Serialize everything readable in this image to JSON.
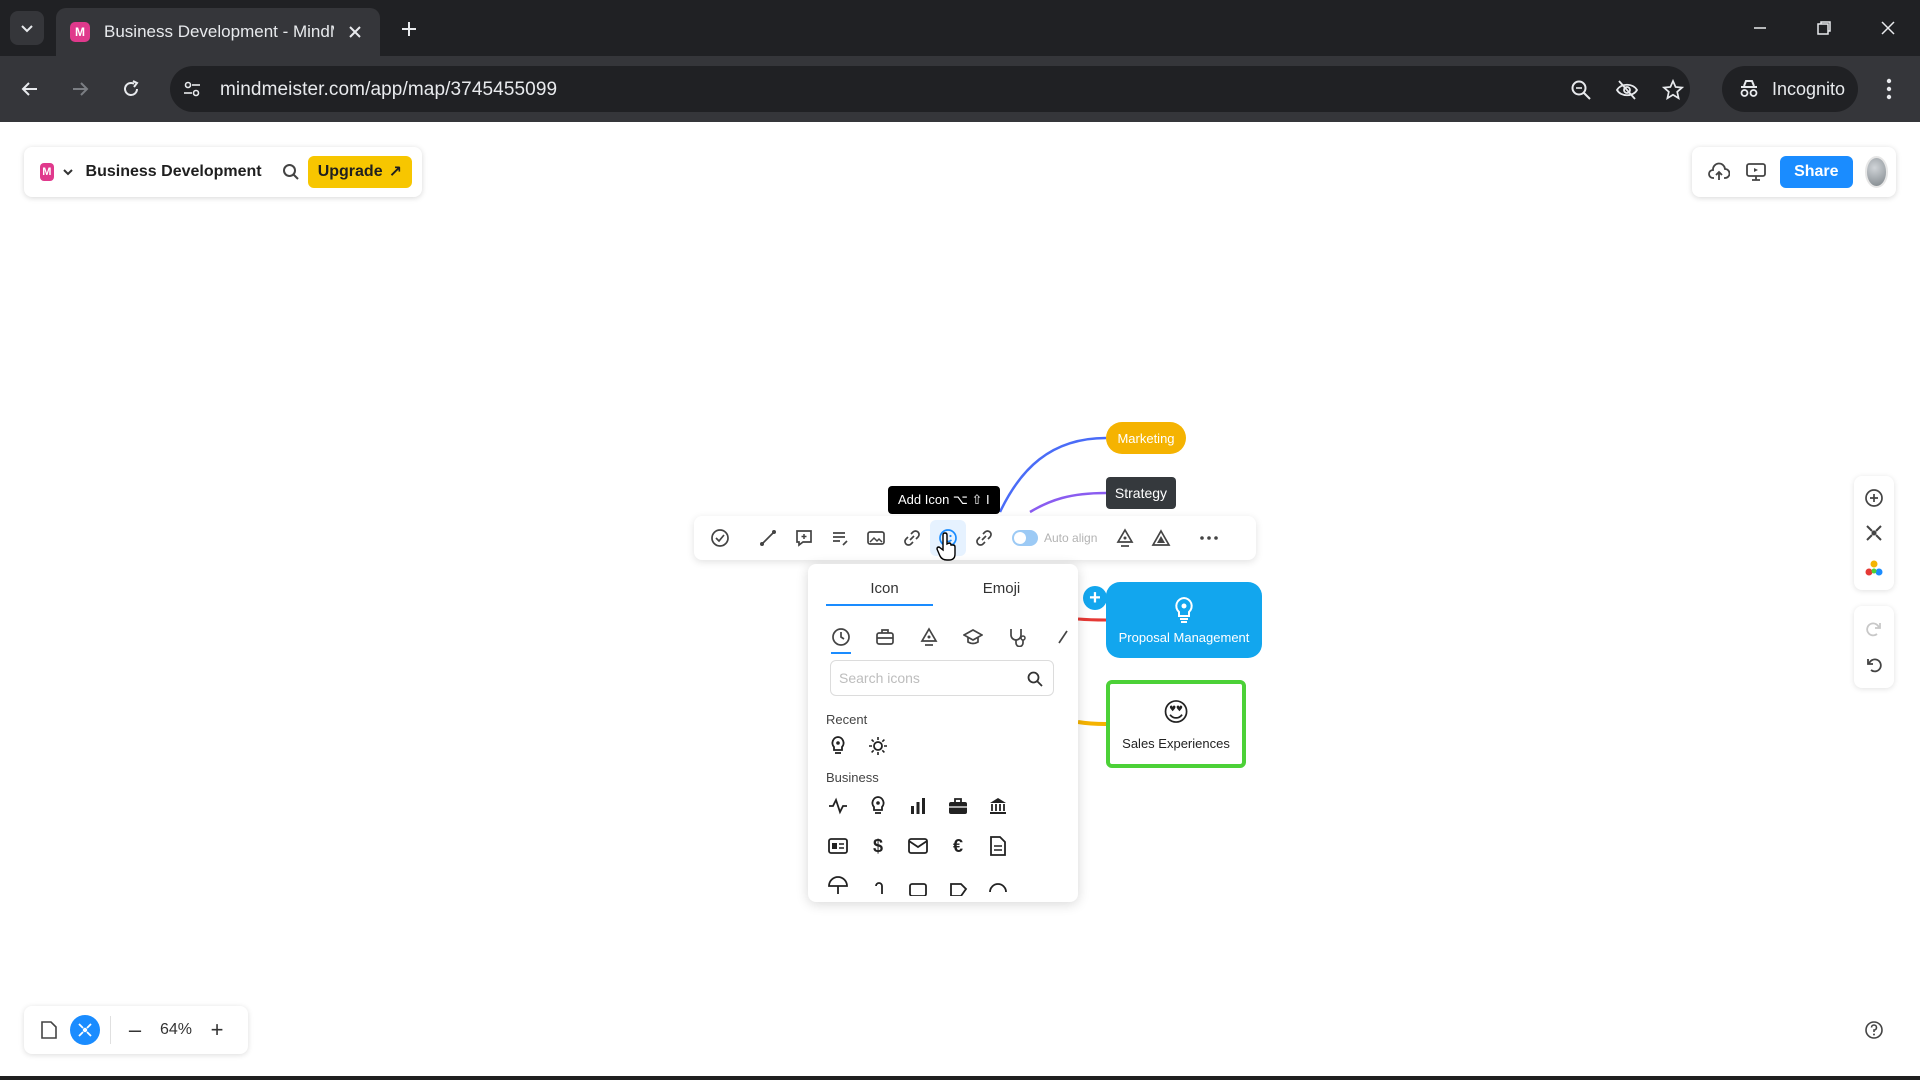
{
  "browser": {
    "tab_title": "Business Development - MindMeister",
    "favicon_letter": "M",
    "url": "mindmeister.com/app/map/3745455099",
    "incognito_label": "Incognito"
  },
  "app": {
    "logo_letter": "M",
    "map_title": "Business Development",
    "upgrade_label": "Upgrade",
    "upgrade_arrow": "↗",
    "share_label": "Share"
  },
  "map": {
    "nodes": {
      "marketing": "Marketing",
      "strategy": "Strategy",
      "proposal": "Proposal Management",
      "sales": "Sales Experiences",
      "sales_emoji": "😍"
    },
    "colors": {
      "marketing": "#f5b301",
      "strategy": "#35393d",
      "proposal": "#12a6ee",
      "sales_border": "#4cd137"
    },
    "add_child": "+"
  },
  "node_toolbar": {
    "auto_align_label": "Auto align",
    "tooltip": "Add Icon ⌥ ⇧ I"
  },
  "icon_picker": {
    "tabs": [
      "Icon",
      "Emoji"
    ],
    "search_placeholder": "Search icons",
    "recent_label": "Recent",
    "business_label": "Business",
    "business_row2_symbols": [
      "$",
      "€"
    ]
  },
  "zoom": {
    "value": "64%",
    "minus": "–",
    "plus": "+"
  }
}
